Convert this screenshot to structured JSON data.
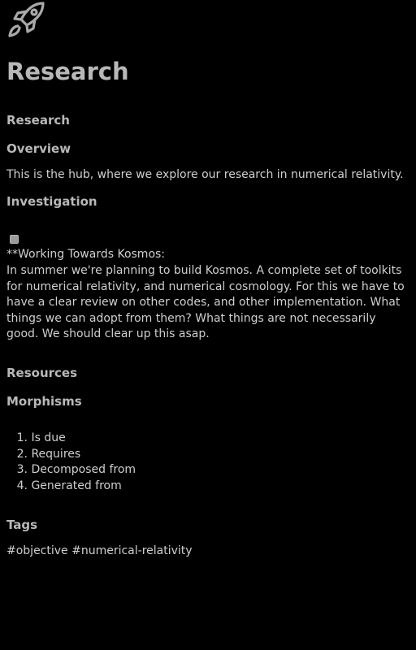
{
  "header": {
    "logo_icon": "rocket-icon",
    "title": "Research"
  },
  "content": {
    "section_heading": "Research",
    "overview": {
      "heading": "Overview",
      "text": "This is the hub, where we explore our research in numerical relativity."
    },
    "investigation": {
      "heading": "Investigation",
      "task": {
        "checked": false,
        "title": "**Working Towards Kosmos:",
        "body": "In summer we're planning to build Kosmos. A complete set of toolkits for numerical relativity, and numerical cosmology. For this we have to have a clear review on other codes, and other implementation. What things we can adopt from them? What things are not necessarily good. We should clear up this asap."
      }
    },
    "resources": {
      "heading": "Resources"
    },
    "morphisms": {
      "heading": "Morphisms",
      "items": [
        {
          "num": "1.",
          "label": "Is due"
        },
        {
          "num": "2.",
          "label": "Requires"
        },
        {
          "num": "3.",
          "label": "Decomposed from"
        },
        {
          "num": "4.",
          "label": "Generated from"
        }
      ]
    },
    "tags": {
      "heading": "Tags",
      "values": "#objective #numerical-relativity"
    }
  },
  "colors": {
    "background": "#000000",
    "heading": "#b8b8b8",
    "text": "#cfcfcf"
  }
}
